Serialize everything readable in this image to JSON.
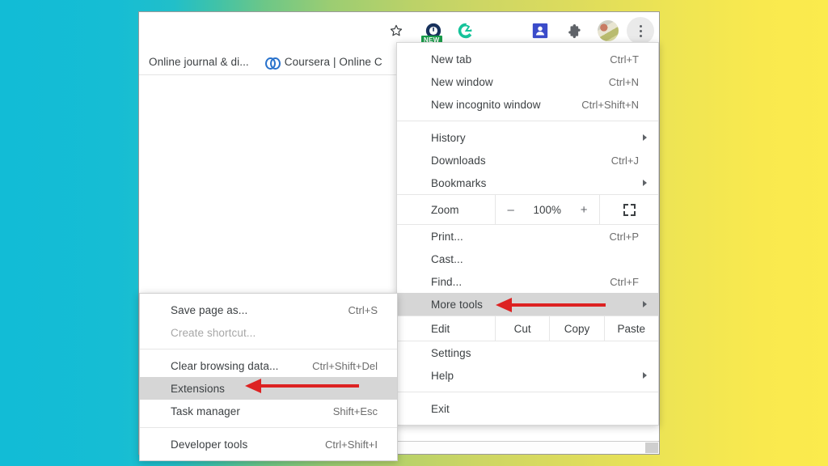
{
  "background": {
    "gradient_from": "#12bcd6",
    "gradient_mid": "#bcd268",
    "gradient_to": "#fbeb4d"
  },
  "browser": {
    "toolbar": {
      "icons": [
        {
          "name": "star-icon",
          "glyph": "☆",
          "title": "Bookmark this tab"
        },
        {
          "name": "extension-new-icon",
          "badge": "NEW",
          "title": "Extension with new badge"
        },
        {
          "name": "grammarly-icon",
          "glyph": "G",
          "color": "#15c39a",
          "title": "Grammarly"
        },
        {
          "name": "blue-square-extension-icon",
          "color": "#3b4cca",
          "title": "Extension"
        },
        {
          "name": "puzzle-icon",
          "title": "Extensions"
        },
        {
          "name": "avatar-icon",
          "title": "Profile"
        },
        {
          "name": "three-dot-menu-icon",
          "title": "Customize and control Google Chrome"
        }
      ]
    },
    "bookmarks_bar": {
      "items": [
        {
          "label": "Online journal & di...",
          "icon": ""
        },
        {
          "label": "Coursera | Online C",
          "icon": "coursera-icon"
        }
      ]
    }
  },
  "chrome_menu": {
    "groups": [
      {
        "items": [
          {
            "label": "New tab",
            "shortcut": "Ctrl+T",
            "submenu": false,
            "highlighted": false
          },
          {
            "label": "New window",
            "shortcut": "Ctrl+N",
            "submenu": false,
            "highlighted": false
          },
          {
            "label": "New incognito window",
            "shortcut": "Ctrl+Shift+N",
            "submenu": false,
            "highlighted": false
          }
        ]
      },
      {
        "items": [
          {
            "label": "History",
            "shortcut": "",
            "submenu": true,
            "highlighted": false
          },
          {
            "label": "Downloads",
            "shortcut": "Ctrl+J",
            "submenu": false,
            "highlighted": false
          },
          {
            "label": "Bookmarks",
            "shortcut": "",
            "submenu": true,
            "highlighted": false
          }
        ]
      }
    ],
    "zoom_row": {
      "label": "Zoom",
      "minus": "–",
      "level": "100%",
      "plus": "+",
      "fullscreen_icon": "fullscreen-icon"
    },
    "group_print": {
      "items": [
        {
          "label": "Print...",
          "shortcut": "Ctrl+P",
          "submenu": false,
          "highlighted": false
        },
        {
          "label": "Cast...",
          "shortcut": "",
          "submenu": false,
          "highlighted": false
        },
        {
          "label": "Find...",
          "shortcut": "Ctrl+F",
          "submenu": false,
          "highlighted": false
        },
        {
          "label": "More tools",
          "shortcut": "",
          "submenu": true,
          "highlighted": true
        }
      ]
    },
    "edit_row": {
      "label": "Edit",
      "actions": [
        "Cut",
        "Copy",
        "Paste"
      ]
    },
    "group_settings": {
      "items": [
        {
          "label": "Settings",
          "shortcut": "",
          "submenu": false,
          "highlighted": false
        },
        {
          "label": "Help",
          "shortcut": "",
          "submenu": true,
          "highlighted": false
        }
      ]
    },
    "group_exit": {
      "items": [
        {
          "label": "Exit",
          "shortcut": "",
          "submenu": false,
          "highlighted": false
        }
      ]
    }
  },
  "more_tools_submenu": {
    "groups": [
      {
        "items": [
          {
            "label": "Save page as...",
            "shortcut": "Ctrl+S",
            "disabled": false,
            "highlighted": false
          },
          {
            "label": "Create shortcut...",
            "shortcut": "",
            "disabled": true,
            "highlighted": false
          }
        ]
      },
      {
        "items": [
          {
            "label": "Clear browsing data...",
            "shortcut": "Ctrl+Shift+Del",
            "disabled": false,
            "highlighted": false
          },
          {
            "label": "Extensions",
            "shortcut": "",
            "disabled": false,
            "highlighted": true
          },
          {
            "label": "Task manager",
            "shortcut": "Shift+Esc",
            "disabled": false,
            "highlighted": false
          }
        ]
      },
      {
        "items": [
          {
            "label": "Developer tools",
            "shortcut": "Ctrl+Shift+I",
            "disabled": false,
            "highlighted": false
          }
        ]
      }
    ]
  },
  "annotations": {
    "arrows": [
      {
        "name": "arrow-pointing-to-more-tools",
        "direction": "left",
        "color": "#dd2222"
      },
      {
        "name": "arrow-pointing-to-extensions",
        "direction": "left",
        "color": "#dd2222"
      }
    ]
  }
}
